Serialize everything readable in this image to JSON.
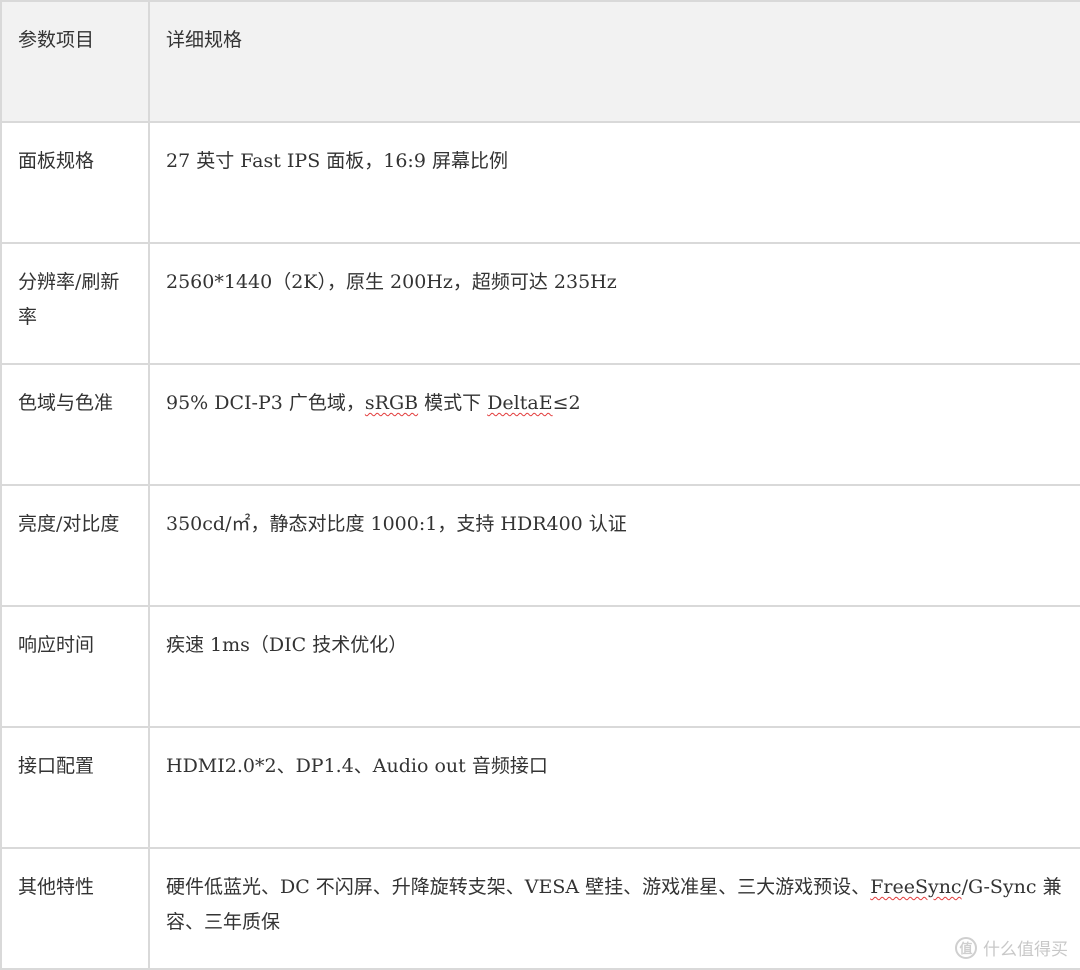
{
  "table": {
    "header": {
      "param": "参数项目",
      "detail": "详细规格"
    },
    "rows": [
      {
        "param": "面板规格",
        "detail": "27 英寸 Fast IPS 面板，16:9 屏幕比例"
      },
      {
        "param": "分辨率/刷新率",
        "detail": "2560*1440（2K），原生 200Hz，超频可达 235Hz"
      },
      {
        "param": "色域与色准",
        "detail_parts": [
          "95% DCI-P3 广色域，",
          "sRGB",
          " 模式下 ",
          "DeltaE",
          "≤2"
        ]
      },
      {
        "param": "亮度/对比度",
        "detail": "350cd/㎡，静态对比度 1000:1，支持 HDR400 认证"
      },
      {
        "param": "响应时间",
        "detail": "疾速 1ms（DIC 技术优化）"
      },
      {
        "param": "接口配置",
        "detail": "HDMI2.0*2、DP1.4、Audio out 音频接口"
      },
      {
        "param": "其他特性",
        "detail_parts": [
          "硬件低蓝光、DC 不闪屏、升降旋转支架、VESA 壁挂、游戏准星、三大游戏预设、",
          "FreeSync",
          "/G-Sync 兼容、三年质保"
        ]
      }
    ]
  },
  "watermark": {
    "logo_glyph": "值",
    "text": "什么值得买"
  },
  "colors": {
    "border": "#d9d9d9",
    "header_bg": "#f2f2f2",
    "text": "#333333",
    "spellcheck_underline": "#e23b3b"
  }
}
